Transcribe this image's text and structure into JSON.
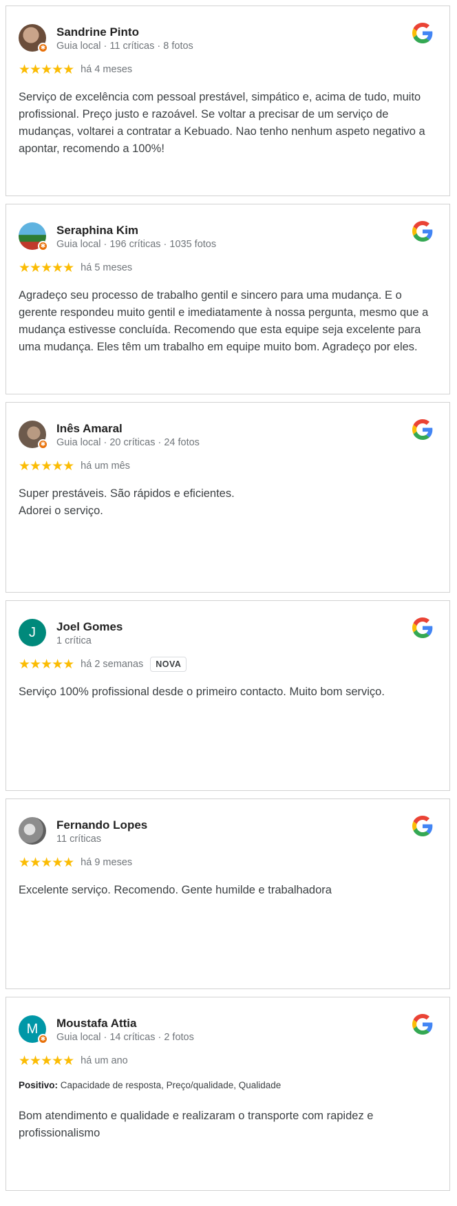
{
  "colors": {
    "star": "#fbbc04",
    "badge": "#e8710a",
    "meta": "#70757a",
    "border": "#d2d2d2"
  },
  "reviews": [
    {
      "name": "Sandrine Pinto",
      "meta": "Guia local · 11 críticas · 8 fotos",
      "stars": "★★★★★",
      "rating": 5,
      "when": "há 4 meses",
      "text": "Serviço de excelência com pessoal prestável, simpático e, acima de tudo, muito profissional. Preço justo e razoável. Se voltar a precisar de um serviço de mudanças, voltarei a contratar a Kebuado. Nao tenho nenhum aspeto negativo a apontar, recomendo a 100%!",
      "avatar_color": "#8a6a55"
    },
    {
      "name": "Seraphina Kim",
      "meta": "Guia local · 196 críticas · 1035 fotos",
      "stars": "★★★★★",
      "rating": 5,
      "when": "há 5 meses",
      "text": "Agradeço seu processo de trabalho gentil e sincero para uma mudança. E o gerente respondeu muito gentil e imediatamente à nossa pergunta, mesmo que a mudança estivesse concluída. Recomendo que esta equipe seja excelente para uma mudança. Eles têm um trabalho em equipe muito bom. Agradeço por eles.",
      "avatar_color": "#3f8fb8"
    },
    {
      "name": "Inês Amaral",
      "meta": "Guia local · 20 críticas · 24 fotos",
      "stars": "★★★★★",
      "rating": 5,
      "when": "há um mês",
      "text": "Super prestáveis. São rápidos e eficientes.\nAdorei o serviço.",
      "avatar_color": "#9a8878"
    },
    {
      "name": "Joel Gomes",
      "meta": "1 crítica",
      "stars": "★★★★★",
      "rating": 5,
      "when": "há 2 semanas",
      "badge": "NOVA",
      "initial": "J",
      "text": "Serviço 100% profissional desde o primeiro contacto. Muito bom serviço.",
      "avatar_color": "#00897b"
    },
    {
      "name": "Fernando Lopes",
      "meta": "11 críticas",
      "stars": "★★★★★",
      "rating": 5,
      "when": "há 9 meses",
      "text": "Excelente serviço. Recomendo. Gente humilde e trabalhadora",
      "avatar_color": "#9e9e9e"
    },
    {
      "name": "Moustafa Attia",
      "meta": "Guia local · 14 críticas · 2 fotos",
      "stars": "★★★★★",
      "rating": 5,
      "when": "há um ano",
      "initial": "M",
      "positive_label": "Positivo:",
      "positive_items": "Capacidade de resposta, Preço/qualidade, Qualidade",
      "text": "Bom atendimento e qualidade e realizaram o transporte com rapidez e profissionalismo",
      "avatar_color": "#0097a7"
    }
  ],
  "icons": {
    "local_guide": "star-badge-icon",
    "source": "google-g-icon"
  }
}
